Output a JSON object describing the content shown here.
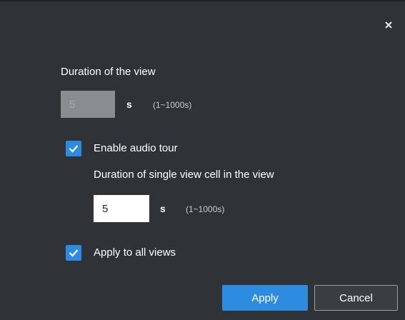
{
  "dialog": {
    "close_icon": "close-icon",
    "duration_label": "Duration of the view",
    "duration_value": "5",
    "duration_unit": "s",
    "duration_range": "(1~1000s)",
    "audio_tour_label": "Enable audio tour",
    "audio_tour_checked": true,
    "cell_duration_label": "Duration of single view cell in the view",
    "cell_duration_value": "5",
    "cell_duration_unit": "s",
    "cell_duration_range": "(1~1000s)",
    "apply_all_label": "Apply to all views",
    "apply_all_checked": true,
    "apply_button": "Apply",
    "cancel_button": "Cancel"
  },
  "colors": {
    "background": "#2f3337",
    "accent": "#2d8ce0",
    "disabled_input": "#8a8d90"
  }
}
